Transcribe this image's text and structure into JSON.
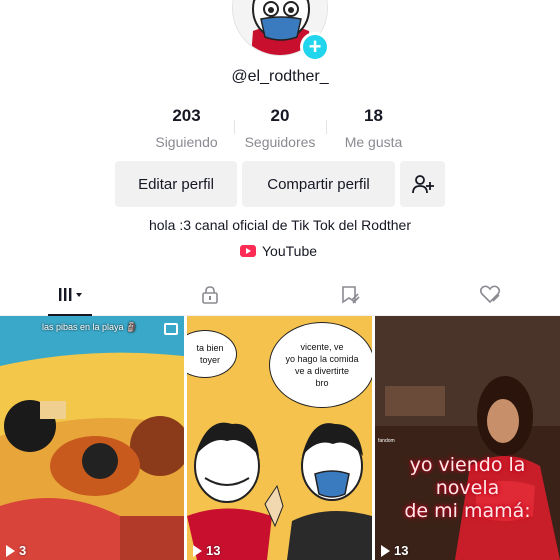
{
  "profile": {
    "username": "@el_rodther_",
    "bio": "hola :3 canal oficial de Tik Tok del Rodther",
    "youtube_label": "YouTube"
  },
  "stats": [
    {
      "value": "203",
      "label": "Siguiendo"
    },
    {
      "value": "20",
      "label": "Seguidores"
    },
    {
      "value": "18",
      "label": "Me gusta"
    }
  ],
  "actions": {
    "edit_label": "Editar perfil",
    "share_label": "Compartir perfil"
  },
  "tabs": [
    {
      "name": "videos",
      "icon": "grid-icon",
      "active": true
    },
    {
      "name": "private",
      "icon": "lock-icon",
      "active": false
    },
    {
      "name": "favorites",
      "icon": "bookmark-icon",
      "active": false
    },
    {
      "name": "liked",
      "icon": "heart-icon",
      "active": false
    }
  ],
  "videos": [
    {
      "caption": "las pibas en la playa 🗿",
      "views": "3"
    },
    {
      "bubble_left": "ta bien\ntoyer",
      "bubble_right": "vicente, ve\nyo hago la comida\nve a divertirte\nbro",
      "views": "13"
    },
    {
      "meme_text": "yo viendo la novela\nde mi mamá:",
      "watermark": "fandom",
      "views": "13"
    }
  ],
  "colors": {
    "accent": "#20d5ec",
    "youtube": "#fe2c55",
    "button_bg": "#f1f1f2",
    "muted_text": "#8a8b91"
  }
}
